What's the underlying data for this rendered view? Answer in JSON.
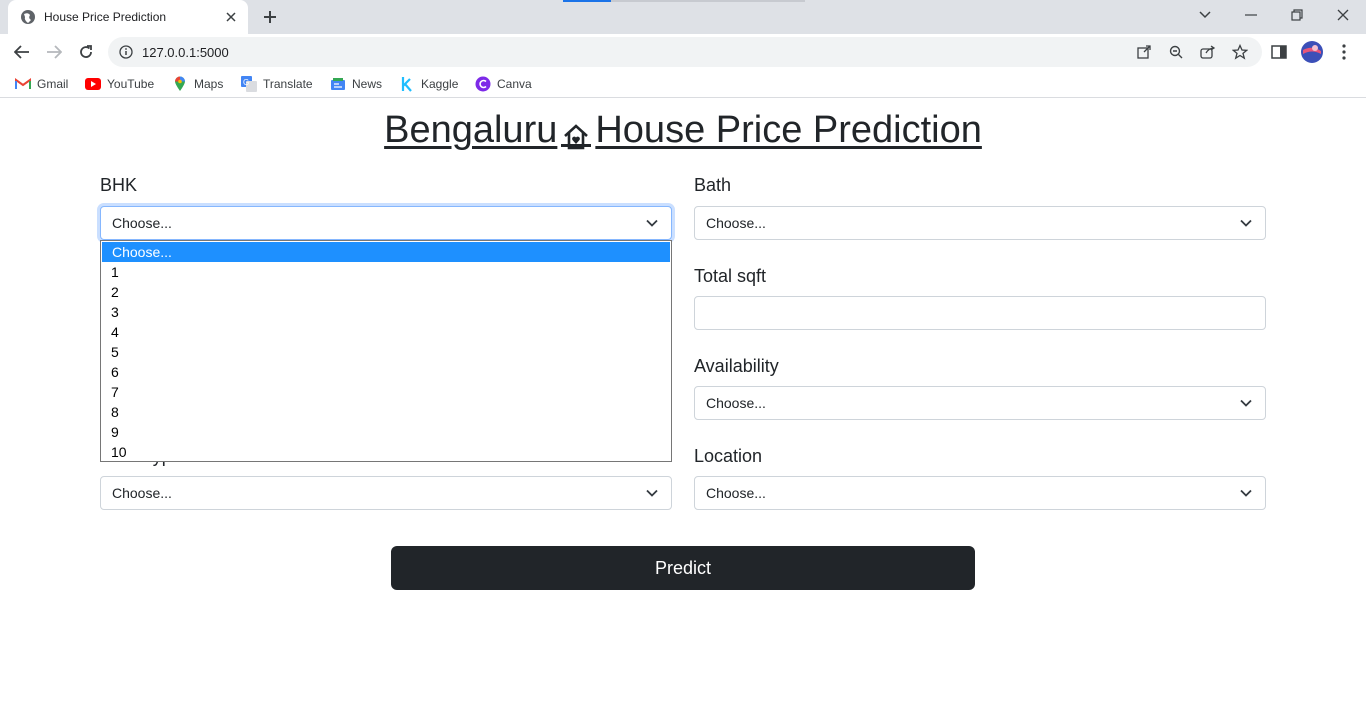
{
  "browser": {
    "tab_title": "House Price Prediction",
    "url": "127.0.0.1:5000",
    "bookmarks": [
      {
        "label": "Gmail",
        "icon": "gmail-icon"
      },
      {
        "label": "YouTube",
        "icon": "youtube-icon"
      },
      {
        "label": "Maps",
        "icon": "maps-icon"
      },
      {
        "label": "Translate",
        "icon": "translate-icon"
      },
      {
        "label": "News",
        "icon": "news-icon"
      },
      {
        "label": "Kaggle",
        "icon": "kaggle-icon"
      },
      {
        "label": "Canva",
        "icon": "canva-icon"
      }
    ]
  },
  "page": {
    "title_left": "Bengaluru",
    "title_right": "House Price Prediction",
    "title_icon": "house-heart-icon",
    "fields": {
      "bhk": {
        "label": "BHK",
        "value": "Choose..."
      },
      "bath": {
        "label": "Bath",
        "value": "Choose..."
      },
      "total_sqft": {
        "label": "Total sqft",
        "value": ""
      },
      "availability": {
        "label": "Availability",
        "value": "Choose..."
      },
      "area_type": {
        "label": "Area Type",
        "value": "Choose..."
      },
      "location": {
        "label": "Location",
        "value": "Choose..."
      }
    },
    "bhk_dropdown_options": [
      "Choose...",
      "1",
      "2",
      "3",
      "4",
      "5",
      "6",
      "7",
      "8",
      "9",
      "10"
    ],
    "predict_label": "Predict"
  },
  "colors": {
    "primary_dark": "#212529",
    "dropdown_highlight": "#1e90ff",
    "focus_border": "#86b7fe"
  }
}
